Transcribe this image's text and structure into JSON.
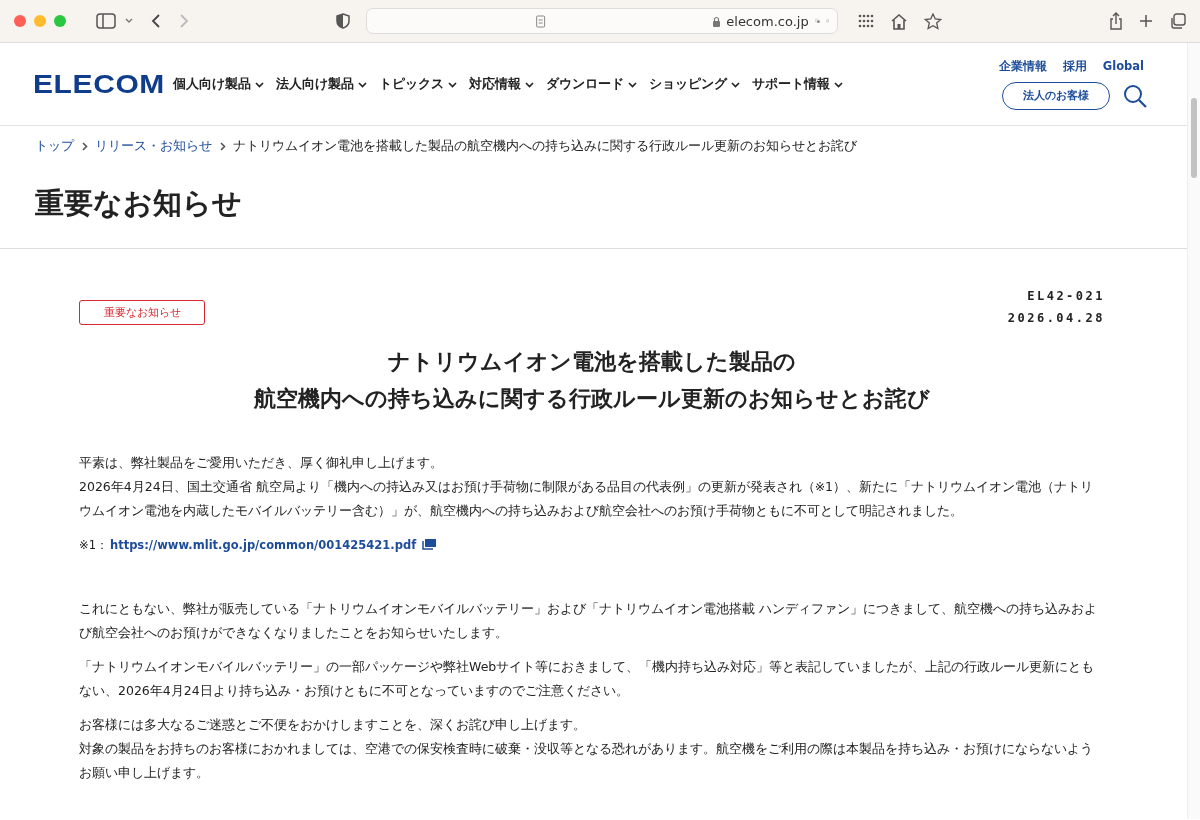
{
  "browser": {
    "address": "elecom.co.jp"
  },
  "header": {
    "logo": "ELECOM",
    "nav": [
      {
        "label": "個人向け製品"
      },
      {
        "label": "法人向け製品"
      },
      {
        "label": "トピックス"
      },
      {
        "label": "対応情報"
      },
      {
        "label": "ダウンロード"
      },
      {
        "label": "ショッピング"
      },
      {
        "label": "サポート情報"
      }
    ],
    "utility_links": [
      "企業情報",
      "採用",
      "Global"
    ],
    "corporate_button": "法人のお客様"
  },
  "breadcrumb": [
    "トップ",
    "リリース・お知らせ",
    "ナトリウムイオン電池を搭載した製品の航空機内への持ち込みに関する行政ルール更新のお知らせとお詫び"
  ],
  "page_title": "重要なお知らせ",
  "article": {
    "tag": "重要なお知らせ",
    "code": "EL42-021",
    "date": "2026.04.28",
    "headline": [
      "ナトリウムイオン電池を搭載した製品の",
      "航空機内への持ち込みに関する行政ルール更新のお知らせとお詫び"
    ],
    "paragraphs": [
      {
        "kind": "text",
        "lines": [
          "平素は、弊社製品をご愛用いただき、厚く御礼申し上げます。",
          "2026年4月24日、国土交通省 航空局より「機内への持込み又はお預け手荷物に制限がある品目の代表例」の更新が発表され（※1）、新たに「ナトリウムイオン電池（ナトリウムイオン電池を内蔵したモバイルバッテリー含む）」が、航空機内への持ち込みおよび航空会社へのお預け手荷物ともに不可として明記されました。"
        ]
      },
      {
        "kind": "note",
        "label": "※1：",
        "link": "https://www.mlit.go.jp/common/001425421.pdf"
      },
      {
        "kind": "text",
        "lines": [
          "これにともない、弊社が販売している「ナトリウムイオンモバイルバッテリー」および「ナトリウムイオン電池搭載 ハンディファン」につきまして、航空機への持ち込みおよび航空会社へのお預けができなくなりましたことをお知らせいたします。"
        ]
      },
      {
        "kind": "text",
        "lines": [
          "「ナトリウムイオンモバイルバッテリー」の一部パッケージや弊社Webサイト等におきまして、「機内持ち込み対応」等と表記していましたが、上記の行政ルール更新にともない、2026年4月24日より持ち込み・お預けともに不可となっていますのでご注意ください。"
        ]
      },
      {
        "kind": "text",
        "lines": [
          "お客様には多大なるご迷惑とご不便をおかけしますことを、深くお詫び申し上げます。",
          "対象の製品をお持ちのお客様におかれましては、空港での保安検査時に破棄・没収等となる恐れがあります。航空機をご利用の際は本製品を持ち込み・お預けにならないようお願い申し上げます。"
        ]
      }
    ]
  }
}
